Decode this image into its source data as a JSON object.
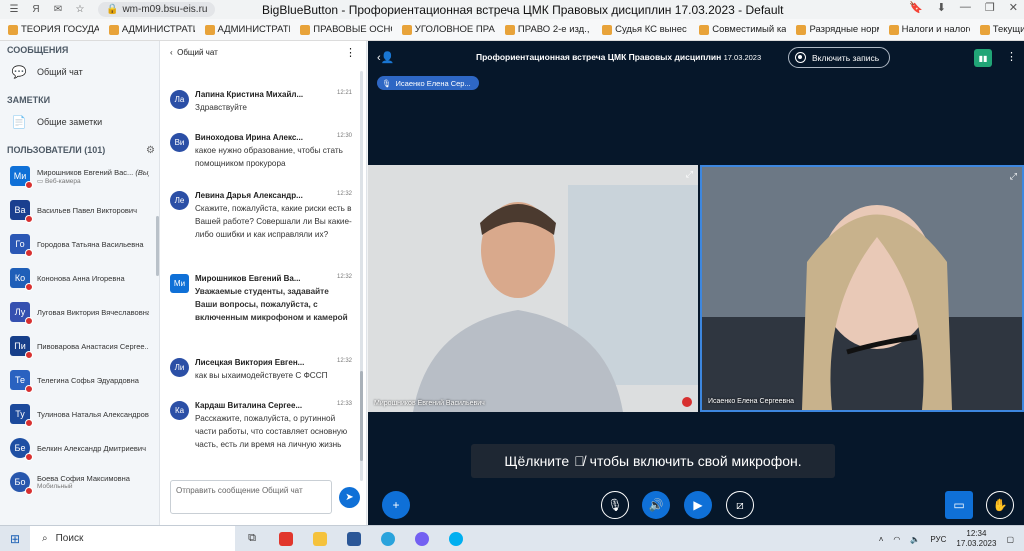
{
  "browser": {
    "url": "wm-m09.bsu-eis.ru",
    "window_title": "BigBlueButton - Профориентационная встреча ЦМК Правовых дисциплин 17.03.2023 - Default",
    "bookmarks": [
      "ТЕОРИЯ ГОСУДАР...",
      "АДМИНИСТРАТИ...",
      "АДМИНИСТРАТИ...",
      "ПРАВОВЫЕ ОСНО...",
      "УГОЛОВНОЕ ПРАВ...",
      "ПРАВО 2-е изд., и...",
      "Судья КС вынес в...",
      "Совместимый кар...",
      "Разрядные норм...",
      "Налоги и налого...",
      "Текущий"
    ]
  },
  "left_panel": {
    "messages_title": "СООБЩЕНИЯ",
    "public_chat": "Общий чат",
    "notes_title": "ЗАМЕТКИ",
    "shared_notes": "Общие заметки",
    "users_title": "ПОЛЬЗОВАТЕЛИ (101)",
    "users": [
      {
        "initials": "Ми",
        "name": "Мирошников Евгений Вас...",
        "you": "(Вы)",
        "sub": "Веб-камера"
      },
      {
        "initials": "Ва",
        "name": "Васильев Павел Викторович",
        "sub": ""
      },
      {
        "initials": "Го",
        "name": "Городова Татьяна Васильевна",
        "sub": ""
      },
      {
        "initials": "Ко",
        "name": "Кононова Анна Игоревна",
        "sub": ""
      },
      {
        "initials": "Лу",
        "name": "Луговая Виктория Вячеславовна",
        "sub": ""
      },
      {
        "initials": "Пи",
        "name": "Пивоварова Анастасия Сергее...",
        "sub": ""
      },
      {
        "initials": "Те",
        "name": "Телегина Софья Эдуардовна",
        "sub": ""
      },
      {
        "initials": "Ту",
        "name": "Тулинова Наталья Александров...",
        "sub": ""
      },
      {
        "initials": "Бе",
        "name": "Белкин Александр Дмитриевич",
        "sub": ""
      },
      {
        "initials": "Бо",
        "name": "Боева София Максимовна",
        "sub": "Мобильный"
      }
    ]
  },
  "chat": {
    "title": "Общий чат",
    "messages": [
      {
        "initials": "Ла",
        "name": "Лапина Кристина Михайл...",
        "time": "12:21",
        "text": "Здравствуйте",
        "bold": false
      },
      {
        "initials": "Ви",
        "name": "Виноходова Ирина Алекс...",
        "time": "12:30",
        "text": "какое нужно образование, чтобы стать помощником прокурора",
        "bold": false
      },
      {
        "initials": "Ле",
        "name": "Левина Дарья Александр...",
        "time": "12:32",
        "text": "Скажите, пожалуйста, какие риски есть в Вашей работе? Совершали ли Вы какие-либо ошибки и как исправляли их?",
        "bold": false
      },
      {
        "initials": "Ми",
        "name": "Мирошников Евгений Ва...",
        "time": "12:32",
        "text": "Уважаемые студенты, задавайте Ваши вопросы, пожалуйста, с включенным микрофоном и камерой",
        "bold": true
      },
      {
        "initials": "Ли",
        "name": "Лисецкая Виктория Евген...",
        "time": "12:32",
        "text": "как вы ыхаимодействуете С ФССП",
        "bold": false
      },
      {
        "initials": "Ка",
        "name": "Кардаш Виталина Сергее...",
        "time": "12:33",
        "text": "Расскажите, пожалуйста, о рутинной части работы, что составляет основную часть, есть ли время на личную жизнь",
        "bold": false
      }
    ],
    "input_placeholder": "Отправить сообщение Общий чат"
  },
  "meeting": {
    "title": "Профориентационная встреча ЦМК Правовых дисциплин",
    "date": "17.03.2023",
    "record_label": "Включить запись",
    "talking": "Исаенко Елена Сер...",
    "videos": [
      {
        "name": "Мирошников Евгений Васильевич"
      },
      {
        "name": "Исаенко Елена Сергеевна"
      }
    ],
    "toast_before": "Щёлкните",
    "toast_after": "чтобы включить свой микрофон."
  },
  "taskbar": {
    "search": "Поиск",
    "lang": "РУС",
    "time": "12:34",
    "date": "17.03.2023"
  }
}
